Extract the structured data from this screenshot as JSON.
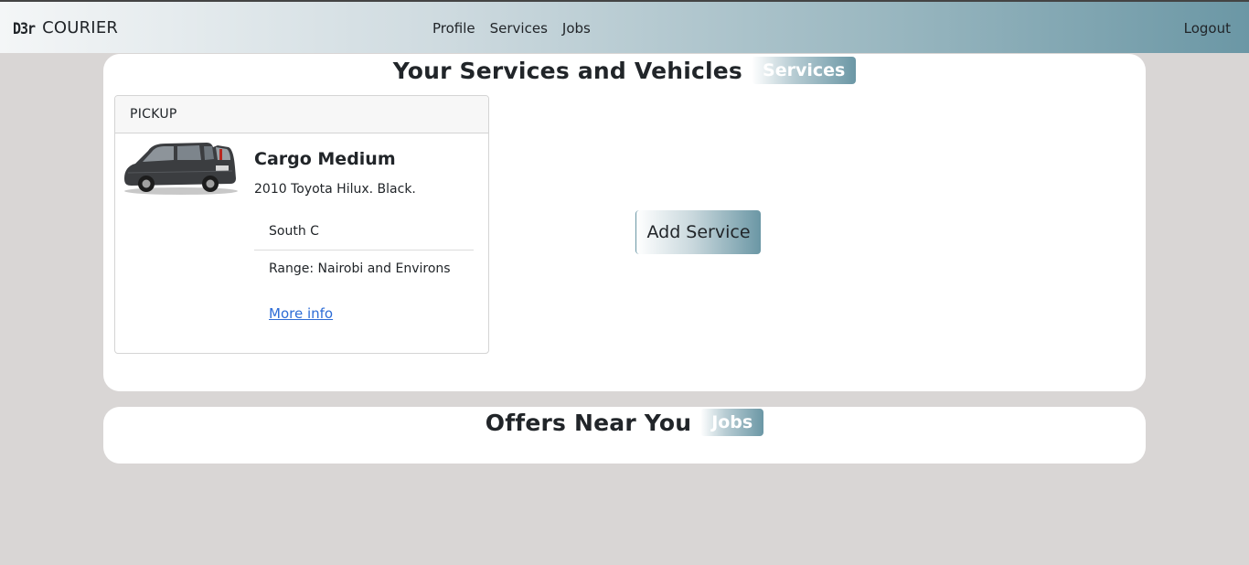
{
  "navbar": {
    "logo_text": "D3r",
    "brand": "COURIER",
    "links": [
      "Profile",
      "Services",
      "Jobs"
    ],
    "logout": "Logout"
  },
  "services_panel": {
    "title": "Your Services and Vehicles",
    "badge": "Services"
  },
  "service_card": {
    "header": "PICKUP",
    "title": "Cargo Medium",
    "subtitle": "2010 Toyota Hilux. Black.",
    "location": "South C",
    "range": "Range: Nairobi and Environs",
    "more_info": "More info"
  },
  "add_service_label": "Add Service",
  "offers_panel": {
    "title": "Offers Near You",
    "badge": "Jobs"
  },
  "colors": {
    "accent": "#6b97a5",
    "background": "#d9d6d5",
    "link": "#2d6cd6"
  }
}
